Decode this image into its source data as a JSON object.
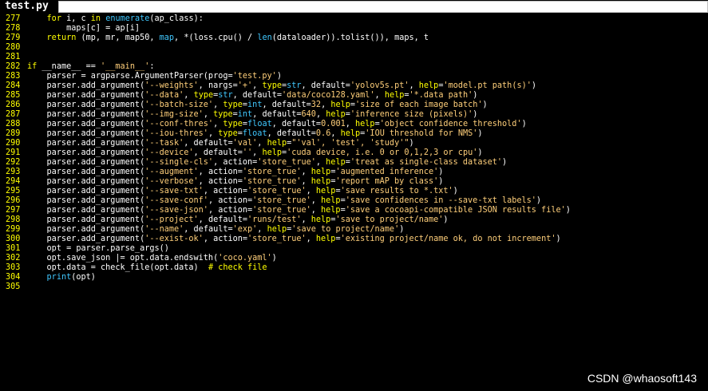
{
  "window": {
    "title": "test.py"
  },
  "colors": {
    "background": "#000000",
    "line_number": "#ffff00",
    "plain": "#ffffff",
    "keyword": "#ffff00",
    "string": "#ffcf7a",
    "number": "#ffcf7a",
    "comment": "#ffff00",
    "name": "#40c8ff"
  },
  "lines": [
    {
      "num": "277",
      "tokens": [
        [
          "p",
          "    "
        ],
        [
          "kw",
          "for"
        ],
        [
          "p",
          " i, c "
        ],
        [
          "kw",
          "in"
        ],
        [
          "p",
          " "
        ],
        [
          "name",
          "enumerate"
        ],
        [
          "p",
          "(ap_class):"
        ]
      ]
    },
    {
      "num": "278",
      "tokens": [
        [
          "p",
          "        maps[c] = ap[i]"
        ]
      ]
    },
    {
      "num": "279",
      "tokens": [
        [
          "p",
          "    "
        ],
        [
          "kw",
          "return"
        ],
        [
          "p",
          " (mp, mr, map50, "
        ],
        [
          "name",
          "map"
        ],
        [
          "p",
          ", *(loss.cpu() / "
        ],
        [
          "name",
          "len"
        ],
        [
          "p",
          "(dataloader)).tolist()), maps, t"
        ]
      ]
    },
    {
      "num": "280",
      "tokens": []
    },
    {
      "num": "281",
      "tokens": []
    },
    {
      "num": "282",
      "tokens": [
        [
          "kw",
          "if"
        ],
        [
          "p",
          " __name__ == "
        ],
        [
          "str",
          "'__main__'"
        ],
        [
          "p",
          ":"
        ]
      ]
    },
    {
      "num": "283",
      "tokens": [
        [
          "p",
          "    parser = argparse.ArgumentParser(prog="
        ],
        [
          "str",
          "'test.py'"
        ],
        [
          "p",
          ")"
        ]
      ]
    },
    {
      "num": "284",
      "tokens": [
        [
          "p",
          "    parser.add_argument("
        ],
        [
          "str",
          "'--weights'"
        ],
        [
          "p",
          ", nargs="
        ],
        [
          "str",
          "'+'"
        ],
        [
          "p",
          ", "
        ],
        [
          "kw",
          "type"
        ],
        [
          "p",
          "="
        ],
        [
          "name",
          "str"
        ],
        [
          "p",
          ", default="
        ],
        [
          "str",
          "'yolov5s.pt'"
        ],
        [
          "p",
          ", "
        ],
        [
          "kw",
          "help"
        ],
        [
          "p",
          "="
        ],
        [
          "str",
          "'model.pt path(s)'"
        ],
        [
          "p",
          ")"
        ]
      ]
    },
    {
      "num": "285",
      "tokens": [
        [
          "p",
          "    parser.add_argument("
        ],
        [
          "str",
          "'--data'"
        ],
        [
          "p",
          ", "
        ],
        [
          "kw",
          "type"
        ],
        [
          "p",
          "="
        ],
        [
          "name",
          "str"
        ],
        [
          "p",
          ", default="
        ],
        [
          "str",
          "'data/coco128.yaml'"
        ],
        [
          "p",
          ", "
        ],
        [
          "kw",
          "help"
        ],
        [
          "p",
          "="
        ],
        [
          "str",
          "'*.data path'"
        ],
        [
          "p",
          ")"
        ]
      ]
    },
    {
      "num": "286",
      "tokens": [
        [
          "p",
          "    parser.add_argument("
        ],
        [
          "str",
          "'--batch-size'"
        ],
        [
          "p",
          ", "
        ],
        [
          "kw",
          "type"
        ],
        [
          "p",
          "="
        ],
        [
          "name",
          "int"
        ],
        [
          "p",
          ", default="
        ],
        [
          "num",
          "32"
        ],
        [
          "p",
          ", "
        ],
        [
          "kw",
          "help"
        ],
        [
          "p",
          "="
        ],
        [
          "str",
          "'size of each image batch'"
        ],
        [
          "p",
          ")"
        ]
      ]
    },
    {
      "num": "287",
      "tokens": [
        [
          "p",
          "    parser.add_argument("
        ],
        [
          "str",
          "'--img-size'"
        ],
        [
          "p",
          ", "
        ],
        [
          "kw",
          "type"
        ],
        [
          "p",
          "="
        ],
        [
          "name",
          "int"
        ],
        [
          "p",
          ", default="
        ],
        [
          "num",
          "640"
        ],
        [
          "p",
          ", "
        ],
        [
          "kw",
          "help"
        ],
        [
          "p",
          "="
        ],
        [
          "str",
          "'inference size (pixels)'"
        ],
        [
          "p",
          ")"
        ]
      ]
    },
    {
      "num": "288",
      "tokens": [
        [
          "p",
          "    parser.add_argument("
        ],
        [
          "str",
          "'--conf-thres'"
        ],
        [
          "p",
          ", "
        ],
        [
          "kw",
          "type"
        ],
        [
          "p",
          "="
        ],
        [
          "name",
          "float"
        ],
        [
          "p",
          ", default="
        ],
        [
          "num",
          "0.001"
        ],
        [
          "p",
          ", "
        ],
        [
          "kw",
          "help"
        ],
        [
          "p",
          "="
        ],
        [
          "str",
          "'object confidence threshold'"
        ],
        [
          "p",
          ")"
        ]
      ]
    },
    {
      "num": "289",
      "tokens": [
        [
          "p",
          "    parser.add_argument("
        ],
        [
          "str",
          "'--iou-thres'"
        ],
        [
          "p",
          ", "
        ],
        [
          "kw",
          "type"
        ],
        [
          "p",
          "="
        ],
        [
          "name",
          "float"
        ],
        [
          "p",
          ", default="
        ],
        [
          "num",
          "0.6"
        ],
        [
          "p",
          ", "
        ],
        [
          "kw",
          "help"
        ],
        [
          "p",
          "="
        ],
        [
          "str",
          "'IOU threshold for NMS'"
        ],
        [
          "p",
          ")"
        ]
      ]
    },
    {
      "num": "290",
      "tokens": [
        [
          "p",
          "    parser.add_argument("
        ],
        [
          "str",
          "'--task'"
        ],
        [
          "p",
          ", default="
        ],
        [
          "str",
          "'val'"
        ],
        [
          "p",
          ", "
        ],
        [
          "kw",
          "help"
        ],
        [
          "p",
          "="
        ],
        [
          "str",
          "\"'val', 'test', 'study'\""
        ],
        [
          "p",
          ")"
        ]
      ]
    },
    {
      "num": "291",
      "tokens": [
        [
          "p",
          "    parser.add_argument("
        ],
        [
          "str",
          "'--device'"
        ],
        [
          "p",
          ", default="
        ],
        [
          "str",
          "''"
        ],
        [
          "p",
          ", "
        ],
        [
          "kw",
          "help"
        ],
        [
          "p",
          "="
        ],
        [
          "str",
          "'cuda device, i.e. 0 or 0,1,2,3 or cpu'"
        ],
        [
          "p",
          ")"
        ]
      ]
    },
    {
      "num": "292",
      "tokens": [
        [
          "p",
          "    parser.add_argument("
        ],
        [
          "str",
          "'--single-cls'"
        ],
        [
          "p",
          ", action="
        ],
        [
          "str",
          "'store_true'"
        ],
        [
          "p",
          ", "
        ],
        [
          "kw",
          "help"
        ],
        [
          "p",
          "="
        ],
        [
          "str",
          "'treat as single-class dataset'"
        ],
        [
          "p",
          ")"
        ]
      ]
    },
    {
      "num": "293",
      "tokens": [
        [
          "p",
          "    parser.add_argument("
        ],
        [
          "str",
          "'--augment'"
        ],
        [
          "p",
          ", action="
        ],
        [
          "str",
          "'store_true'"
        ],
        [
          "p",
          ", "
        ],
        [
          "kw",
          "help"
        ],
        [
          "p",
          "="
        ],
        [
          "str",
          "'augmented inference'"
        ],
        [
          "p",
          ")"
        ]
      ]
    },
    {
      "num": "294",
      "tokens": [
        [
          "p",
          "    parser.add_argument("
        ],
        [
          "str",
          "'--verbose'"
        ],
        [
          "p",
          ", action="
        ],
        [
          "str",
          "'store_true'"
        ],
        [
          "p",
          ", "
        ],
        [
          "kw",
          "help"
        ],
        [
          "p",
          "="
        ],
        [
          "str",
          "'report mAP by class'"
        ],
        [
          "p",
          ")"
        ]
      ]
    },
    {
      "num": "295",
      "tokens": [
        [
          "p",
          "    parser.add_argument("
        ],
        [
          "str",
          "'--save-txt'"
        ],
        [
          "p",
          ", action="
        ],
        [
          "str",
          "'store_true'"
        ],
        [
          "p",
          ", "
        ],
        [
          "kw",
          "help"
        ],
        [
          "p",
          "="
        ],
        [
          "str",
          "'save results to *.txt'"
        ],
        [
          "p",
          ")"
        ]
      ]
    },
    {
      "num": "296",
      "tokens": [
        [
          "p",
          "    parser.add_argument("
        ],
        [
          "str",
          "'--save-conf'"
        ],
        [
          "p",
          ", action="
        ],
        [
          "str",
          "'store_true'"
        ],
        [
          "p",
          ", "
        ],
        [
          "kw",
          "help"
        ],
        [
          "p",
          "="
        ],
        [
          "str",
          "'save confidences in --save-txt labels'"
        ],
        [
          "p",
          ")"
        ]
      ]
    },
    {
      "num": "297",
      "tokens": [
        [
          "p",
          "    parser.add_argument("
        ],
        [
          "str",
          "'--save-json'"
        ],
        [
          "p",
          ", action="
        ],
        [
          "str",
          "'store_true'"
        ],
        [
          "p",
          ", "
        ],
        [
          "kw",
          "help"
        ],
        [
          "p",
          "="
        ],
        [
          "str",
          "'save a cocoapi-compatible JSON results file'"
        ],
        [
          "p",
          ")"
        ]
      ]
    },
    {
      "num": "298",
      "tokens": [
        [
          "p",
          "    parser.add_argument("
        ],
        [
          "str",
          "'--project'"
        ],
        [
          "p",
          ", default="
        ],
        [
          "str",
          "'runs/test'"
        ],
        [
          "p",
          ", "
        ],
        [
          "kw",
          "help"
        ],
        [
          "p",
          "="
        ],
        [
          "str",
          "'save to project/name'"
        ],
        [
          "p",
          ")"
        ]
      ]
    },
    {
      "num": "299",
      "tokens": [
        [
          "p",
          "    parser.add_argument("
        ],
        [
          "str",
          "'--name'"
        ],
        [
          "p",
          ", default="
        ],
        [
          "str",
          "'exp'"
        ],
        [
          "p",
          ", "
        ],
        [
          "kw",
          "help"
        ],
        [
          "p",
          "="
        ],
        [
          "str",
          "'save to project/name'"
        ],
        [
          "p",
          ")"
        ]
      ]
    },
    {
      "num": "300",
      "tokens": [
        [
          "p",
          "    parser.add_argument("
        ],
        [
          "str",
          "'--exist-ok'"
        ],
        [
          "p",
          ", action="
        ],
        [
          "str",
          "'store_true'"
        ],
        [
          "p",
          ", "
        ],
        [
          "kw",
          "help"
        ],
        [
          "p",
          "="
        ],
        [
          "str",
          "'existing project/name ok, do not increment'"
        ],
        [
          "p",
          ")"
        ]
      ]
    },
    {
      "num": "301",
      "tokens": [
        [
          "p",
          "    opt = parser.parse_args()"
        ]
      ]
    },
    {
      "num": "302",
      "tokens": [
        [
          "p",
          "    opt.save_json |= opt.data.endswith("
        ],
        [
          "str",
          "'coco.yaml'"
        ],
        [
          "p",
          ")"
        ]
      ]
    },
    {
      "num": "303",
      "tokens": [
        [
          "p",
          "    opt.data = check_file(opt.data)  "
        ],
        [
          "cmt",
          "# check file"
        ]
      ]
    },
    {
      "num": "304",
      "tokens": [
        [
          "p",
          "    "
        ],
        [
          "name",
          "print"
        ],
        [
          "p",
          "(opt)"
        ]
      ]
    },
    {
      "num": "305",
      "tokens": []
    }
  ],
  "watermark": "CSDN @whaosoft143"
}
